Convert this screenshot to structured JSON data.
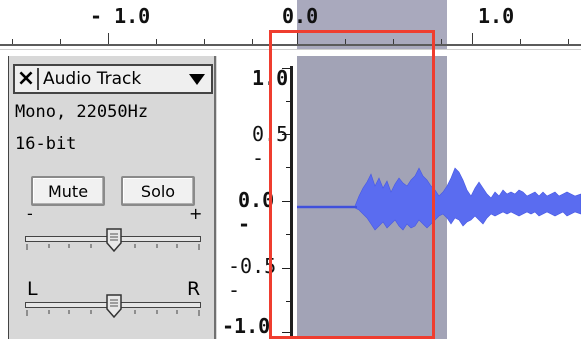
{
  "ruler": {
    "labels": [
      "- 1.0",
      "0.0",
      "1.0"
    ]
  },
  "track": {
    "close_glyph": "×",
    "name": "Audio Track",
    "format_line1": "Mono, 22050Hz",
    "format_line2": "16-bit",
    "mute_label": "Mute",
    "solo_label": "Solo",
    "gain": {
      "minus_label": "-",
      "plus_label": "+"
    },
    "pan": {
      "left_label": "L",
      "right_label": "R"
    }
  },
  "amplitude_axis": {
    "labels": [
      "1.0",
      "0.5 -",
      "0.0 -",
      "-0.5 -",
      "-1.0"
    ]
  },
  "colors": {
    "selection_fill": "#a2a3b6",
    "waveform": "#5a6cf0",
    "highlight_box": "#ef3d2f"
  }
}
